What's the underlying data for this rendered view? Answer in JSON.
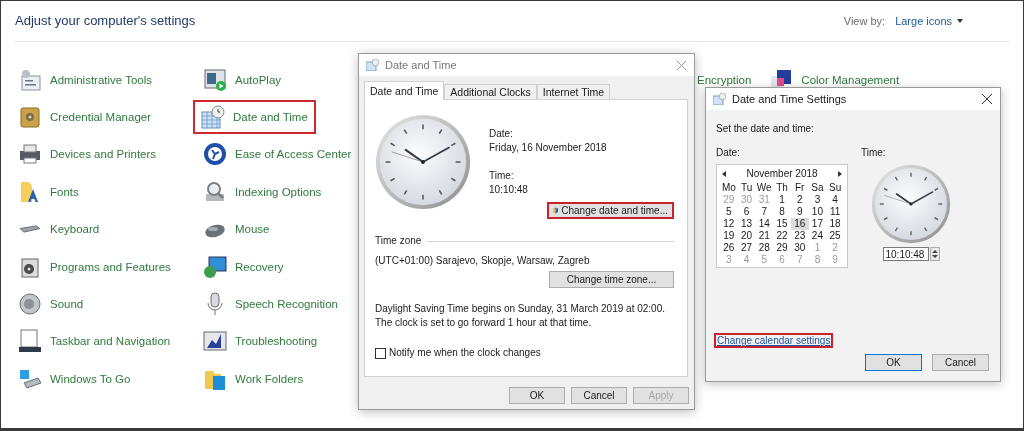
{
  "header": {
    "title": "Adjust your computer's settings",
    "view_by_label": "View by:",
    "view_by_value": "Large icons"
  },
  "columns": [
    {
      "items": [
        {
          "label": "Administrative Tools",
          "highlighted": false
        },
        {
          "label": "Credential Manager",
          "highlighted": false
        },
        {
          "label": "Devices and Printers",
          "highlighted": false
        },
        {
          "label": "Fonts",
          "highlighted": false
        },
        {
          "label": "Keyboard",
          "highlighted": false
        },
        {
          "label": "Programs and Features",
          "highlighted": false
        },
        {
          "label": "Sound",
          "highlighted": false
        },
        {
          "label": "Taskbar and Navigation",
          "highlighted": false
        },
        {
          "label": "Windows To Go",
          "highlighted": false
        }
      ]
    },
    {
      "items": [
        {
          "label": "AutoPlay",
          "highlighted": false
        },
        {
          "label": "Date and Time",
          "highlighted": true
        },
        {
          "label": "Ease of Access Center",
          "highlighted": false
        },
        {
          "label": "Indexing Options",
          "highlighted": false
        },
        {
          "label": "Mouse",
          "highlighted": false
        },
        {
          "label": "Recovery",
          "highlighted": false
        },
        {
          "label": "Speech Recognition",
          "highlighted": false
        },
        {
          "label": "Troubleshooting",
          "highlighted": false
        },
        {
          "label": "Work Folders",
          "highlighted": false
        }
      ]
    }
  ],
  "partial_items": [
    {
      "label": "Encryption"
    },
    {
      "label": "Color Management"
    }
  ],
  "date_time_dialog": {
    "title": "Date and Time",
    "tabs": [
      {
        "label": "Date and Time",
        "selected": true
      },
      {
        "label": "Additional Clocks",
        "selected": false
      },
      {
        "label": "Internet Time",
        "selected": false
      }
    ],
    "date_label": "Date:",
    "date": "Friday, 16 November 2018",
    "time_label": "Time:",
    "time": "10:10:48",
    "change_button": {
      "label": "Change date and time...",
      "highlighted": true
    },
    "timezone_heading": "Time zone",
    "timezone": "(UTC+01:00) Sarajevo, Skopje, Warsaw, Zagreb",
    "timezone_button": "Change time zone...",
    "dst_note": "Daylight Saving Time begins on Sunday, 31 March 2019 at 02:00. The clock is set to go forward 1 hour at that time.",
    "notify": {
      "label": "Notify me when the clock changes",
      "checked": false
    },
    "buttons": [
      {
        "label": "OK",
        "disabled": false
      },
      {
        "label": "Cancel",
        "disabled": false
      },
      {
        "label": "Apply",
        "disabled": true
      }
    ]
  },
  "settings_dialog": {
    "title": "Date and Time Settings",
    "prompt": "Set the date and time:",
    "date_label": "Date:",
    "time_label": "Time:",
    "calendar": {
      "month": "November 2018",
      "weekdays": [
        "Mo",
        "Tu",
        "We",
        "Th",
        "Fr",
        "Sa",
        "Su"
      ],
      "weeks": [
        [
          {
            "day": "29",
            "other_month": true,
            "selected": false
          },
          {
            "day": "30",
            "other_month": true,
            "selected": false
          },
          {
            "day": "31",
            "other_month": true,
            "selected": false
          },
          {
            "day": "1",
            "other_month": false,
            "selected": false
          },
          {
            "day": "2",
            "other_month": false,
            "selected": false
          },
          {
            "day": "3",
            "other_month": false,
            "selected": false
          },
          {
            "day": "4",
            "other_month": false,
            "selected": false
          }
        ],
        [
          {
            "day": "5",
            "other_month": false,
            "selected": false
          },
          {
            "day": "6",
            "other_month": false,
            "selected": false
          },
          {
            "day": "7",
            "other_month": false,
            "selected": false
          },
          {
            "day": "8",
            "other_month": false,
            "selected": false
          },
          {
            "day": "9",
            "other_month": false,
            "selected": false
          },
          {
            "day": "10",
            "other_month": false,
            "selected": false
          },
          {
            "day": "11",
            "other_month": false,
            "selected": false
          }
        ],
        [
          {
            "day": "12",
            "other_month": false,
            "selected": false
          },
          {
            "day": "13",
            "other_month": false,
            "selected": false
          },
          {
            "day": "14",
            "other_month": false,
            "selected": false
          },
          {
            "day": "15",
            "other_month": false,
            "selected": false
          },
          {
            "day": "16",
            "other_month": false,
            "selected": true
          },
          {
            "day": "17",
            "other_month": false,
            "selected": false
          },
          {
            "day": "18",
            "other_month": false,
            "selected": false
          }
        ],
        [
          {
            "day": "19",
            "other_month": false,
            "selected": false
          },
          {
            "day": "20",
            "other_month": false,
            "selected": false
          },
          {
            "day": "21",
            "other_month": false,
            "selected": false
          },
          {
            "day": "22",
            "other_month": false,
            "selected": false
          },
          {
            "day": "23",
            "other_month": false,
            "selected": false
          },
          {
            "day": "24",
            "other_month": false,
            "selected": false
          },
          {
            "day": "25",
            "other_month": false,
            "selected": false
          }
        ],
        [
          {
            "day": "26",
            "other_month": false,
            "selected": false
          },
          {
            "day": "27",
            "other_month": false,
            "selected": false
          },
          {
            "day": "28",
            "other_month": false,
            "selected": false
          },
          {
            "day": "29",
            "other_month": false,
            "selected": false
          },
          {
            "day": "30",
            "other_month": false,
            "selected": false
          },
          {
            "day": "1",
            "other_month": true,
            "selected": false
          },
          {
            "day": "2",
            "other_month": true,
            "selected": false
          }
        ],
        [
          {
            "day": "3",
            "other_month": true,
            "selected": false
          },
          {
            "day": "4",
            "other_month": true,
            "selected": false
          },
          {
            "day": "5",
            "other_month": true,
            "selected": false
          },
          {
            "day": "6",
            "other_month": true,
            "selected": false
          },
          {
            "day": "7",
            "other_month": true,
            "selected": false
          },
          {
            "day": "8",
            "other_month": true,
            "selected": false
          },
          {
            "day": "9",
            "other_month": true,
            "selected": false
          }
        ]
      ]
    },
    "time_value": "10:10:48",
    "link": {
      "label": "Change calendar settings",
      "highlighted": true
    },
    "buttons": [
      {
        "label": "OK",
        "default": true
      },
      {
        "label": "Cancel",
        "default": false
      }
    ]
  }
}
